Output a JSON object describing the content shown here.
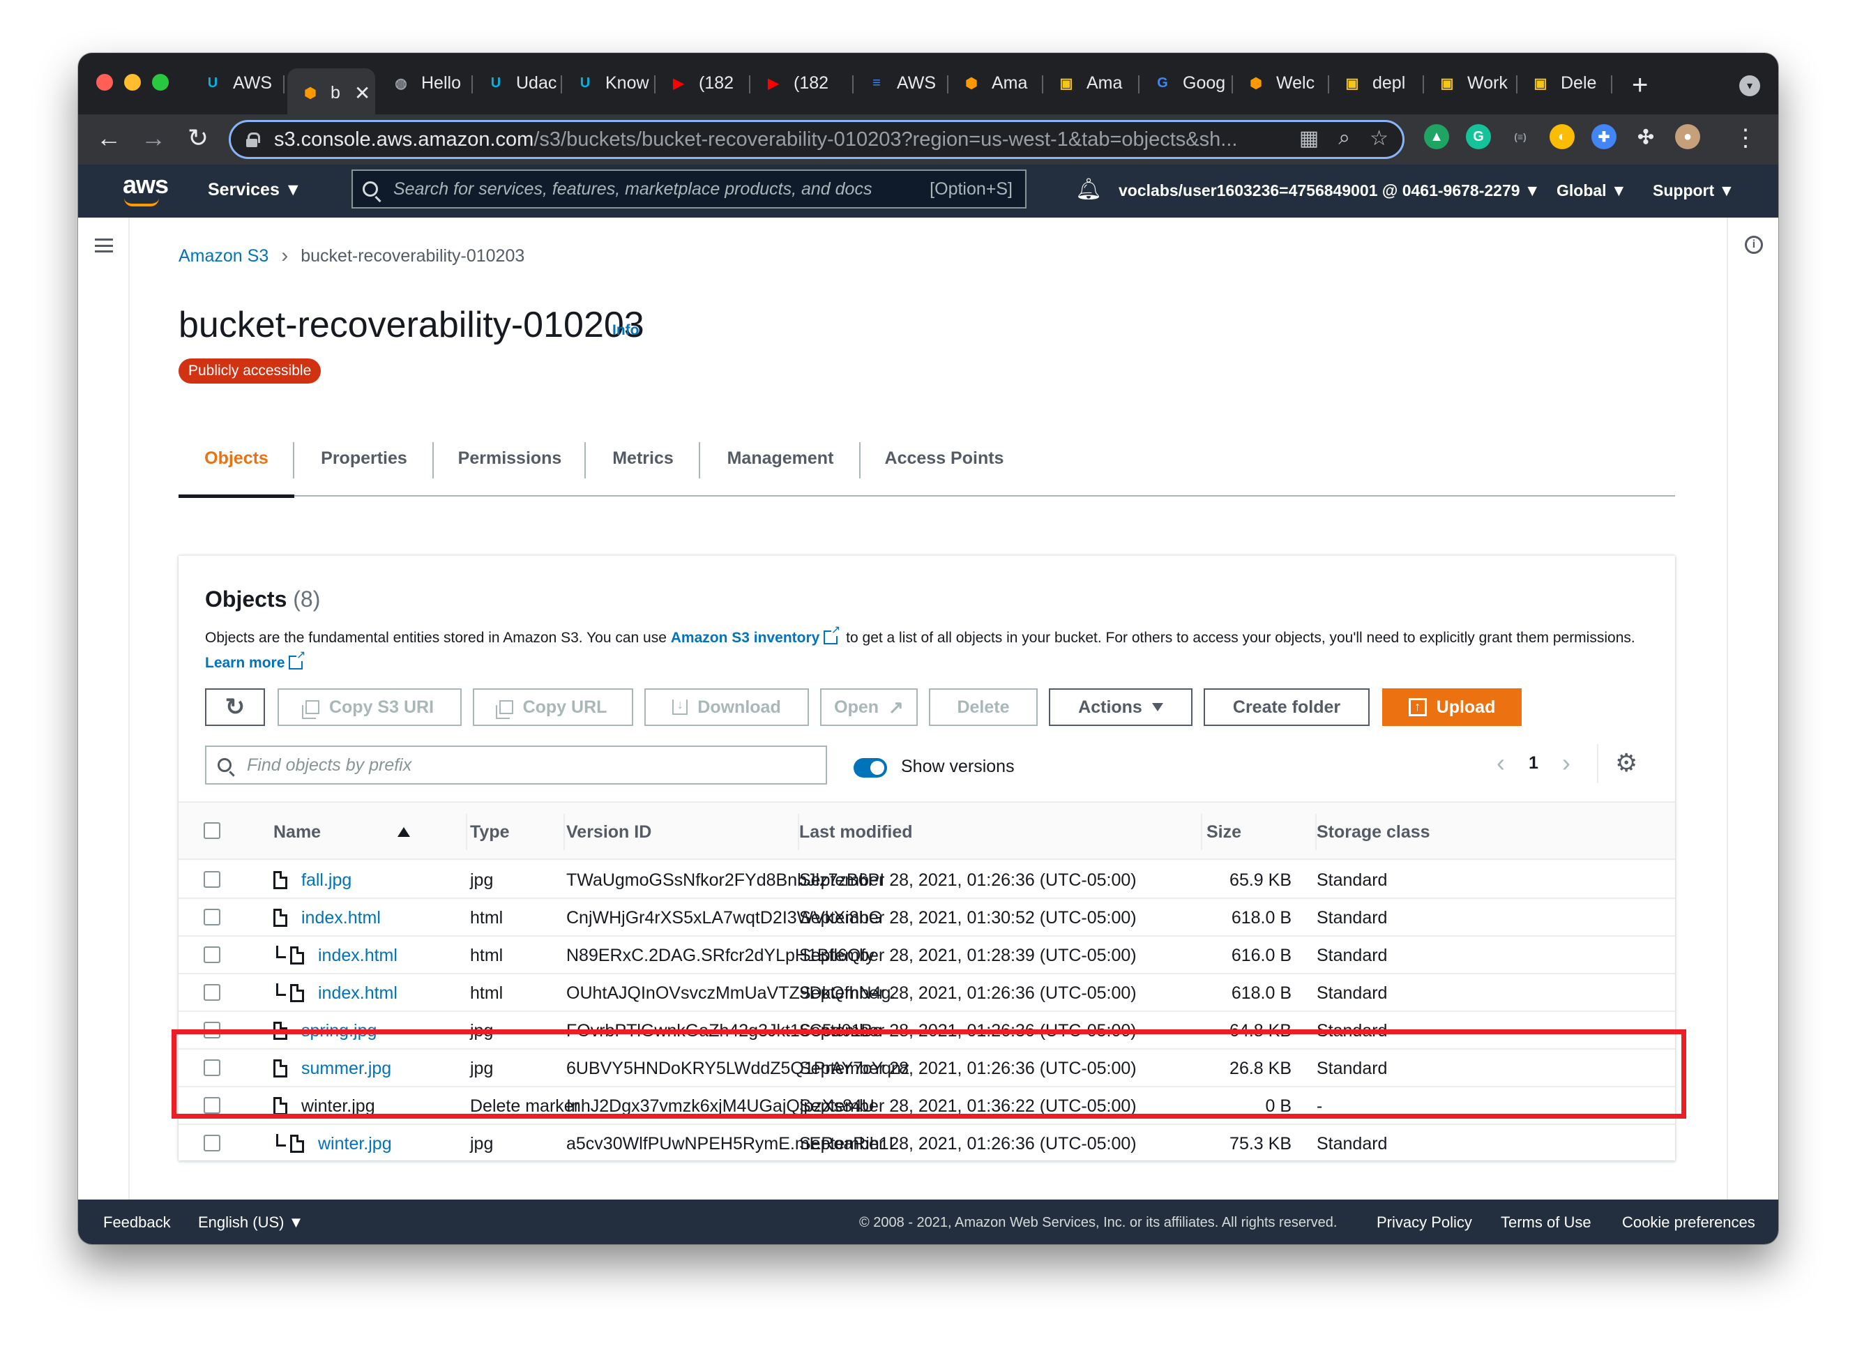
{
  "browser": {
    "tabs": [
      {
        "label": "AWS",
        "icon": "udacity-icon",
        "color": "#02b3e4"
      },
      {
        "label": "b",
        "icon": "aws-s3-icon",
        "color": "#ff9900",
        "active": true
      },
      {
        "label": "Hello",
        "icon": "globe-icon",
        "color": "#9aa0a6"
      },
      {
        "label": "Udac",
        "icon": "udacity-icon",
        "color": "#02b3e4"
      },
      {
        "label": "Know",
        "icon": "udacity-icon",
        "color": "#02b3e4"
      },
      {
        "label": "(182",
        "icon": "youtube-icon",
        "color": "#ff0000"
      },
      {
        "label": "(182",
        "icon": "youtube-icon",
        "color": "#ff0000"
      },
      {
        "label": "AWS",
        "icon": "docs-icon",
        "color": "#4285f4"
      },
      {
        "label": "Ama",
        "icon": "aws-s3-icon",
        "color": "#ff9900"
      },
      {
        "label": "Ama",
        "icon": "aws-box-icon",
        "color": "#f5c518"
      },
      {
        "label": "Goog",
        "icon": "google-translate-icon",
        "color": "#4285f4"
      },
      {
        "label": "Welc",
        "icon": "aws-s3-icon",
        "color": "#ff9900"
      },
      {
        "label": "depl",
        "icon": "aws-box-icon",
        "color": "#f5c518"
      },
      {
        "label": "Work",
        "icon": "aws-box-icon",
        "color": "#f5c518"
      },
      {
        "label": "Dele",
        "icon": "aws-box-icon",
        "color": "#f5c518"
      }
    ],
    "url_host": "s3.console.aws.amazon.com",
    "url_path": "/s3/buckets/bucket-recoverability-010203?region=us-west-1&tab=objects&sh..."
  },
  "aws": {
    "logo": "aws",
    "services": "Services",
    "search_placeholder": "Search for services, features, marketplace products, and docs",
    "search_shortcut": "[Option+S]",
    "account": "voclabs/user1603236=4756849001 @ 0461-9678-2279",
    "region": "Global",
    "support": "Support"
  },
  "breadcrumb": {
    "root": "Amazon S3",
    "current": "bucket-recoverability-010203"
  },
  "page": {
    "title": "bucket-recoverability-010203",
    "info": "Info",
    "badge": "Publicly accessible"
  },
  "tabs": [
    "Objects",
    "Properties",
    "Permissions",
    "Metrics",
    "Management",
    "Access Points"
  ],
  "objects": {
    "title": "Objects",
    "count": "(8)",
    "desc_1": "Objects are the fundamental entities stored in Amazon S3. You can use ",
    "desc_link": "Amazon S3 inventory",
    "desc_2": " to get a list of all objects in your bucket. For others to access your objects, you'll need to explicitly grant them permissions. ",
    "learn_more": "Learn more",
    "buttons": {
      "copy_s3_uri": "Copy S3 URI",
      "copy_url": "Copy URL",
      "download": "Download",
      "open": "Open",
      "delete": "Delete",
      "actions": "Actions",
      "create_folder": "Create folder",
      "upload": "Upload"
    },
    "find_placeholder": "Find objects by prefix",
    "show_versions": "Show versions",
    "page": "1",
    "columns": [
      "Name",
      "Type",
      "Version ID",
      "Last modified",
      "Size",
      "Storage class"
    ],
    "rows": [
      {
        "name": "fall.jpg",
        "type": "jpg",
        "version": "TWaUgmoGSsNfkor2FYd8BnbJlz7zB6PI",
        "modified": "September 28, 2021, 01:26:36 (UTC-05:00)",
        "size": "65.9 KB",
        "storage": "Standard"
      },
      {
        "name": "index.html",
        "type": "html",
        "version": "CnjWHjGr4rXS5xLA7wqtD2I3WVkXi8hG",
        "modified": "September 28, 2021, 01:30:52 (UTC-05:00)",
        "size": "618.0 B",
        "storage": "Standard"
      },
      {
        "name": "index.html",
        "type": "html",
        "version": "N89ERxC.2DAG.SRfcr2dYLpH1Bfl6Qfy",
        "modified": "September 28, 2021, 01:28:39 (UTC-05:00)",
        "size": "616.0 B",
        "storage": "Standard"
      },
      {
        "name": "index.html",
        "type": "html",
        "version": "OUhtAJQInOVsvczMmUaVTZ9DkQfhN4g.",
        "modified": "September 28, 2021, 01:26:36 (UTC-05:00)",
        "size": "618.0 B",
        "storage": "Standard"
      },
      {
        "name": "spring.jpg",
        "type": "jpg",
        "version": "FOvrbPTlGwnkGaZh42g3Jkt16C5d01Be",
        "modified": "September 28, 2021, 01:26:36 (UTC-05:00)",
        "size": "64.8 KB",
        "storage": "Standard"
      },
      {
        "name": "summer.jpg",
        "type": "jpg",
        "version": "6UBVY5HNDoKRY5LWddZ5Q1PrAY7cYqnz",
        "modified": "September 28, 2021, 01:26:36 (UTC-05:00)",
        "size": "26.8 KB",
        "storage": "Standard"
      },
      {
        "name": "winter.jpg",
        "type": "Delete marker",
        "version": "InhJ2Dgx37vmzk6xjM4UGajQjpzXs84U",
        "modified": "September 28, 2021, 01:36:22 (UTC-05:00)",
        "size": "0 B",
        "storage": "-"
      },
      {
        "name": "winter.jpg",
        "type": "jpg",
        "version": "a5cv30WlfPUwNPEH5RymE.mERoaRih1L",
        "modified": "September 28, 2021, 01:26:36 (UTC-05:00)",
        "size": "75.3 KB",
        "storage": "Standard"
      }
    ]
  },
  "footer": {
    "feedback": "Feedback",
    "language": "English (US)",
    "copyright": "© 2008 - 2021, Amazon Web Services, Inc. or its affiliates. All rights reserved.",
    "privacy": "Privacy Policy",
    "terms": "Terms of Use",
    "cookies": "Cookie preferences"
  },
  "colors": {
    "aws_orange": "#ec7211",
    "link_blue": "#0073bb",
    "danger_red": "#d13212",
    "highlight_red": "#ee1c25"
  }
}
